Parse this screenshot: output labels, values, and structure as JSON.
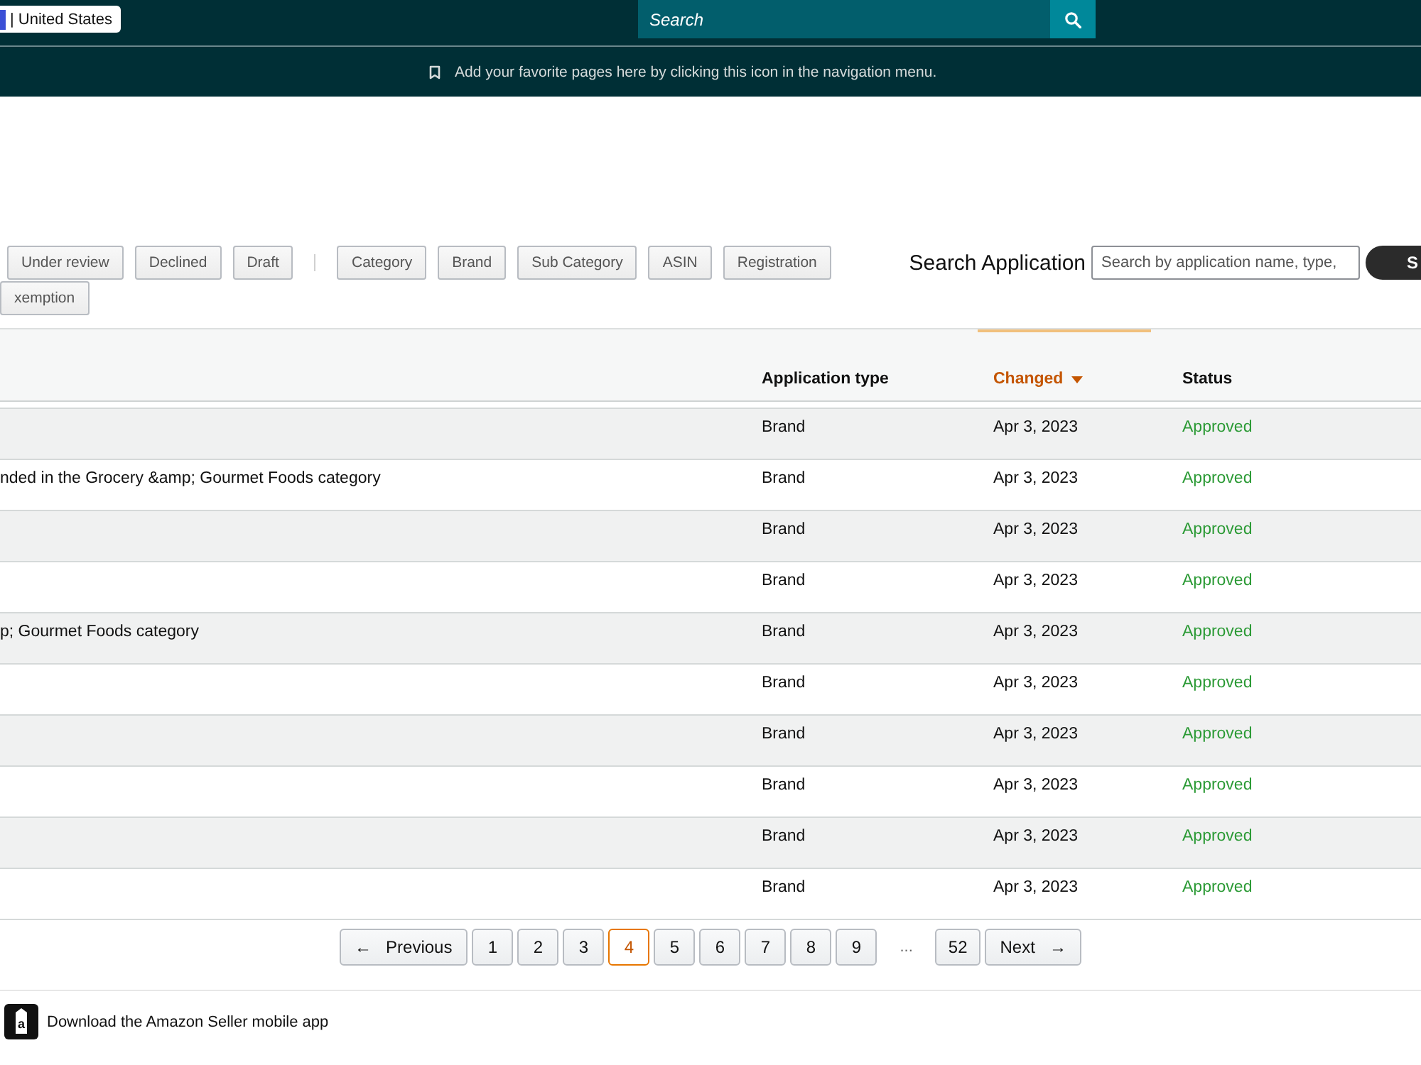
{
  "top_bar": {
    "region": "| United States",
    "search": {
      "placeholder": "Search"
    }
  },
  "favorites_tip": "Add your favorite pages here by clicking this icon in the navigation menu.",
  "status_filters": [
    {
      "label": "Under review",
      "selected": false
    },
    {
      "label": "Declined",
      "selected": false
    },
    {
      "label": "Draft",
      "selected": false
    }
  ],
  "type_filters": [
    {
      "label": "Category",
      "selected": false
    },
    {
      "label": "Brand",
      "selected": false
    },
    {
      "label": "Sub Category",
      "selected": false
    },
    {
      "label": "ASIN",
      "selected": false
    },
    {
      "label": "Registration",
      "selected": false
    },
    {
      "label": "xemption",
      "selected": false
    }
  ],
  "search_application": {
    "label": "Search Application",
    "placeholder": "Search by application name, type,",
    "button": "S"
  },
  "table": {
    "columns": [
      {
        "label": "Application type",
        "sorted": false
      },
      {
        "label": "Changed",
        "sorted": true
      },
      {
        "label": "Status",
        "sorted": false
      }
    ],
    "rows": [
      {
        "type": "Brand",
        "changed": "Apr 3, 2023",
        "status": "Approved"
      },
      {
        "name": "nded in the Grocery &amp; Gourmet Foods category",
        "type": "Brand",
        "changed": "Apr 3, 2023",
        "status": "Approved"
      },
      {
        "type": "Brand",
        "changed": "Apr 3, 2023",
        "status": "Approved"
      },
      {
        "type": "Brand",
        "changed": "Apr 3, 2023",
        "status": "Approved"
      },
      {
        "name": "p; Gourmet Foods category",
        "type": "Brand",
        "changed": "Apr 3, 2023",
        "status": "Approved"
      },
      {
        "type": "Brand",
        "changed": "Apr 3, 2023",
        "status": "Approved"
      },
      {
        "type": "Brand",
        "changed": "Apr 3, 2023",
        "status": "Approved"
      },
      {
        "type": "Brand",
        "changed": "Apr 3, 2023",
        "status": "Approved"
      },
      {
        "type": "Brand",
        "changed": "Apr 3, 2023",
        "status": "Approved"
      },
      {
        "type": "Brand",
        "changed": "Apr 3, 2023",
        "status": "Approved"
      }
    ]
  },
  "pagination": {
    "previous": {
      "arrow": "←",
      "label": "Previous"
    },
    "pages": [
      {
        "label": "1",
        "selected": false
      },
      {
        "label": "2",
        "selected": false
      },
      {
        "label": "3",
        "selected": false
      },
      {
        "label": "4",
        "selected": true
      },
      {
        "label": "5",
        "selected": false
      },
      {
        "label": "6",
        "selected": false
      },
      {
        "label": "7",
        "selected": false
      },
      {
        "label": "8",
        "selected": false
      },
      {
        "label": "9",
        "selected": false
      }
    ],
    "ellipsis": "...",
    "last_page": {
      "label": "52",
      "selected": false
    },
    "next": {
      "label": "Next",
      "arrow": "→"
    }
  },
  "footer": {
    "icon_letter": "a",
    "text": "Download the Amazon Seller mobile app"
  }
}
